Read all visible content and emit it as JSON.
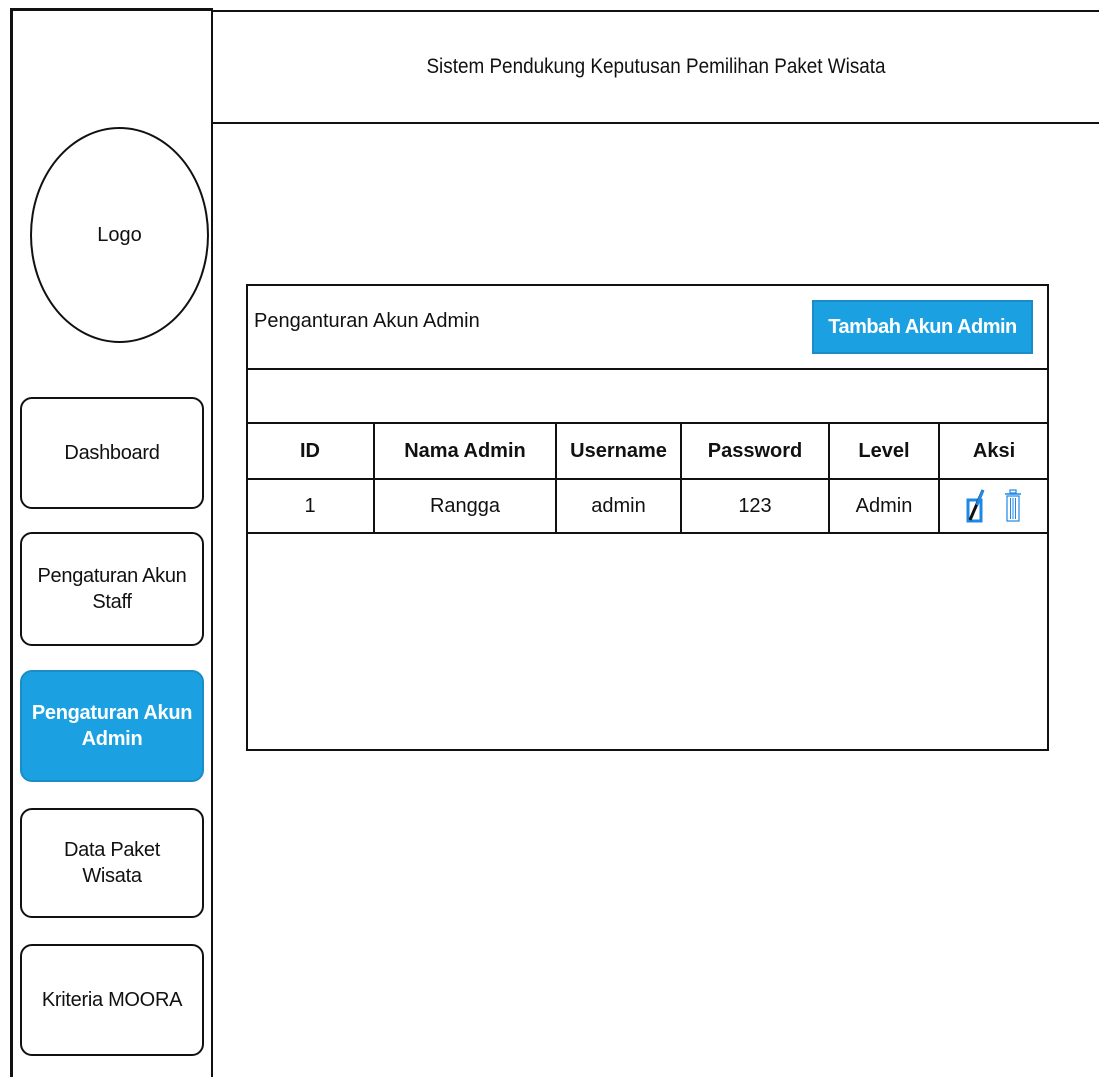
{
  "header": {
    "title": "Sistem Pendukung Keputusan Pemilihan Paket Wisata"
  },
  "sidebar": {
    "logo_label": "Logo",
    "items": [
      {
        "label": "Dashboard"
      },
      {
        "label": "Pengaturan Akun\nStaff"
      },
      {
        "label": "Pengaturan Akun\nAdmin",
        "active": true
      },
      {
        "label": "Data Paket\nWisata"
      },
      {
        "label": "Kriteria MOORA"
      }
    ]
  },
  "panel": {
    "title": "Penganturan Akun Admin",
    "add_button_label": "Tambah Akun Admin",
    "table": {
      "columns": [
        "ID",
        "Nama Admin",
        "Username",
        "Password",
        "Level",
        "Aksi"
      ],
      "rows": [
        {
          "id": "1",
          "nama": "Rangga",
          "username": "admin",
          "password": "123",
          "level": "Admin",
          "actions": [
            "edit-icon",
            "trash-icon"
          ]
        }
      ]
    }
  },
  "colors": {
    "accent": "#1ba1e2",
    "accent_border": "#1a8cc7",
    "icon_blue": "#1e88e5"
  }
}
